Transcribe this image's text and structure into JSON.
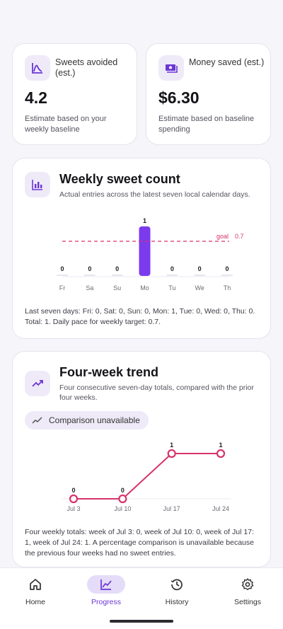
{
  "stats": [
    {
      "label": "Sweets avoided (est.)",
      "value": "4.2",
      "note": "Estimate based on your weekly baseline",
      "icon": "trend-chart-icon"
    },
    {
      "label": "Money saved (est.)",
      "value": "$6.30",
      "note": "Estimate based on baseline spending",
      "icon": "cash-icon"
    }
  ],
  "weekly": {
    "title": "Weekly sweet count",
    "subtitle": "Actual entries across the latest seven local calendar days.",
    "summary": "Last seven days: Fri: 0, Sat: 0, Sun: 0, Mon: 1, Tue: 0, Wed: 0, Thu: 0. Total: 1. Daily pace for weekly target: 0.7.",
    "icon": "bar-chart-icon"
  },
  "trend": {
    "title": "Four-week trend",
    "subtitle": "Four consecutive seven-day totals, compared with the prior four weeks.",
    "chip_label": "Comparison unavailable",
    "summary": "Four weekly totals: week of Jul 3: 0, week of Jul 10: 0, week of Jul 17: 1, week of Jul 24: 1. A percentage comparison is unavailable because the previous four weeks had no sweet entries.",
    "icon": "trending-up-icon"
  },
  "chart_data": [
    {
      "type": "bar",
      "categories": [
        "Fr",
        "Sa",
        "Su",
        "Mo",
        "Tu",
        "We",
        "Th"
      ],
      "values": [
        0,
        0,
        0,
        1,
        0,
        0,
        0
      ],
      "goal": 0.7,
      "goal_label": "goal",
      "goal_value_label": "0.7",
      "ylim": [
        0,
        1
      ],
      "bar_color": "#7c3aed",
      "goal_color": "#d6336c"
    },
    {
      "type": "line",
      "x": [
        "Jul 3",
        "Jul 10",
        "Jul 17",
        "Jul 24"
      ],
      "values": [
        0,
        0,
        1,
        1
      ],
      "ylim": [
        0,
        1
      ],
      "line_color": "#d6336c"
    }
  ],
  "nav": [
    {
      "label": "Home",
      "icon": "home-icon",
      "active": false
    },
    {
      "label": "Progress",
      "icon": "progress-chart-icon",
      "active": true
    },
    {
      "label": "History",
      "icon": "history-icon",
      "active": false
    },
    {
      "label": "Settings",
      "icon": "gear-icon",
      "active": false
    }
  ],
  "colors": {
    "accent": "#6b36d6",
    "bar": "#7c3aed",
    "goal": "#d6336c",
    "line": "#d6336c"
  }
}
